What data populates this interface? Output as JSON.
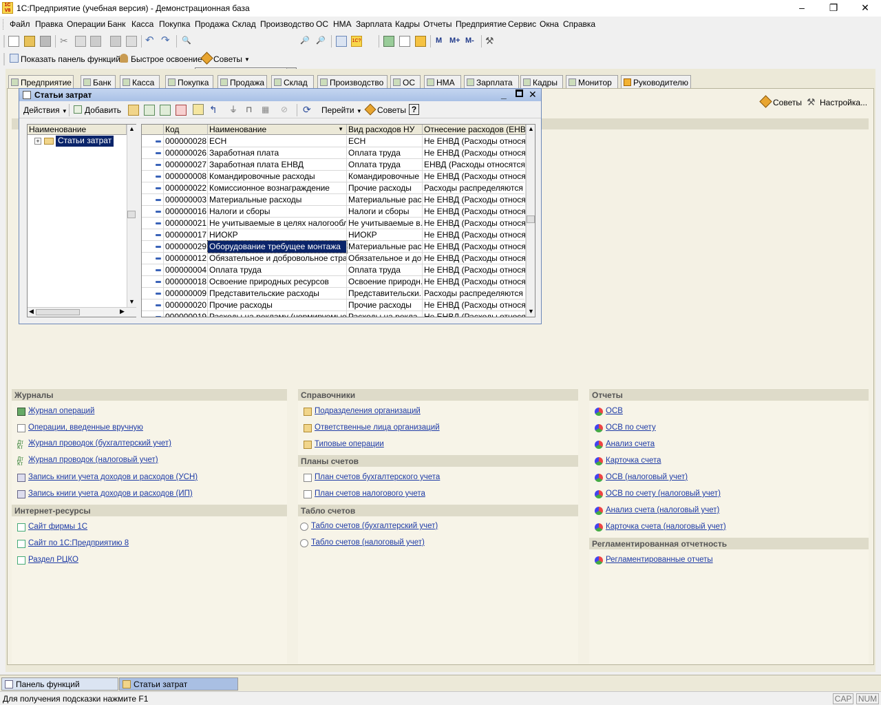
{
  "window": {
    "title": "1С:Предприятие (учебная версия) - Демонстрационная база",
    "app_icon_text": "1C V8",
    "controls": {
      "minimize": "–",
      "restore": "❐",
      "close": "✕"
    }
  },
  "menu": [
    "Файл",
    "Правка",
    "Операции",
    "Банк",
    "Касса",
    "Покупка",
    "Продажа",
    "Склад",
    "Производство",
    "ОС",
    "НМА",
    "Зарплата",
    "Кадры",
    "Отчеты",
    "Предприятие",
    "Сервис",
    "Окна",
    "Справка"
  ],
  "toolbar2": {
    "items": [
      {
        "label": "Показать панель функций",
        "icon": "panel-icon"
      },
      {
        "label": "Быстрое освоение",
        "icon": "person-icon"
      },
      {
        "label": "Советы",
        "icon": "tips-icon"
      }
    ]
  },
  "function_tabs": [
    {
      "label": "Предприятие"
    },
    {
      "label": "Банк"
    },
    {
      "label": "Касса"
    },
    {
      "label": "Покупка"
    },
    {
      "label": "Продажа"
    },
    {
      "label": "Склад"
    },
    {
      "label": "Производство"
    },
    {
      "label": "ОС"
    },
    {
      "label": "НМА"
    },
    {
      "label": "Зарплата"
    },
    {
      "label": "Кадры"
    },
    {
      "label": "Монитор"
    },
    {
      "label": "Руководителю"
    }
  ],
  "panel_toolbar": {
    "tips": "Советы",
    "settings": "Настройка..."
  },
  "catalog_window": {
    "title": "Статьи затрат",
    "toolbar": {
      "actions": "Действия",
      "add": "Добавить",
      "goto": "Перейти",
      "tips": "Советы",
      "help": "?"
    },
    "tree": {
      "header": "Наименование",
      "root": "Статьи затрат"
    },
    "grid": {
      "columns": [
        "Код",
        "Наименование",
        "Вид расходов НУ",
        "Отнесение расходов (ЕНВД)"
      ],
      "rows": [
        {
          "code": "000000028",
          "name": "ЕСН",
          "type": "ЕСН",
          "envd": "Не ЕНВД (Расходы относя..."
        },
        {
          "code": "000000026",
          "name": "Заработная плата",
          "type": "Оплата труда",
          "envd": "Не ЕНВД (Расходы относя..."
        },
        {
          "code": "000000027",
          "name": "Заработная плата ЕНВД",
          "type": "Оплата труда",
          "envd": "ЕНВД (Расходы относятся..."
        },
        {
          "code": "000000008",
          "name": "Командировочные расходы",
          "type": "Командировочные ...",
          "envd": "Не ЕНВД (Расходы относя..."
        },
        {
          "code": "000000022",
          "name": "Комиссионное вознаграждение",
          "type": "Прочие расходы",
          "envd": "Расходы распределяются"
        },
        {
          "code": "000000003",
          "name": "Материальные расходы",
          "type": "Материальные рас...",
          "envd": "Не ЕНВД (Расходы относя..."
        },
        {
          "code": "000000016",
          "name": "Налоги и сборы",
          "type": "Налоги и сборы",
          "envd": "Не ЕНВД (Расходы относя..."
        },
        {
          "code": "000000021",
          "name": "Не учитываемые в целях налогообло...",
          "type": "Не учитываемые в...",
          "envd": "Не ЕНВД (Расходы относя..."
        },
        {
          "code": "000000017",
          "name": "НИОКР",
          "type": "НИОКР",
          "envd": "Не ЕНВД (Расходы относя..."
        },
        {
          "code": "000000029",
          "name": "Оборудование требущее монтажа",
          "type": "Материальные рас...",
          "envd": "Не ЕНВД (Расходы относя...",
          "selected": true
        },
        {
          "code": "000000012",
          "name": "Обязательное и добровольное страх...",
          "type": "Обязательное и до...",
          "envd": "Не ЕНВД (Расходы относя..."
        },
        {
          "code": "000000004",
          "name": "Оплата труда",
          "type": "Оплата труда",
          "envd": "Не ЕНВД (Расходы относя..."
        },
        {
          "code": "000000018",
          "name": "Освоение природных ресурсов",
          "type": "Освоение природн...",
          "envd": "Не ЕНВД (Расходы относя..."
        },
        {
          "code": "000000009",
          "name": "Представительские расходы",
          "type": "Представительски...",
          "envd": "Расходы распределяются"
        },
        {
          "code": "000000020",
          "name": "Прочие расходы",
          "type": "Прочие расходы",
          "envd": "Не ЕНВД (Расходы относя..."
        },
        {
          "code": "000000019",
          "name": "Расходы на рекламу (нормируемые)",
          "type": "Расходы на рекла...",
          "envd": "Не ЕНВД (Расходы относя..."
        }
      ]
    }
  },
  "sections": {
    "journals": {
      "title": "Журналы",
      "links": [
        "Журнал операций",
        "Операции, введенные вручную",
        "Журнал проводок (бухгалтерский учет)",
        "Журнал проводок (налоговый учет)",
        "Запись книги учета доходов и расходов (УСН)",
        "Запись книги учета доходов и расходов (ИП)"
      ]
    },
    "internet": {
      "title": "Интернет-ресурсы",
      "links": [
        "Сайт фирмы 1С",
        "Сайт по 1С:Предприятию 8",
        "Раздел РЦКО"
      ]
    },
    "catalogs": {
      "title": "Справочники",
      "links": [
        "Подразделения организаций",
        "Ответственные лица организаций",
        "Типовые операции"
      ]
    },
    "charts": {
      "title": "Планы счетов",
      "links": [
        "План счетов бухгалтерского учета",
        "План счетов налогового учета"
      ]
    },
    "tablo": {
      "title": "Табло счетов",
      "links": [
        "Табло счетов (бухгалтерский учет)",
        "Табло счетов (налоговый учет)"
      ]
    },
    "reports": {
      "title": "Отчеты",
      "links": [
        "ОСВ",
        "ОСВ по счету",
        "Анализ счета",
        "Карточка счета",
        "ОСВ (налоговый учет)",
        "ОСВ по счету (налоговый учет)",
        "Анализ счета (налоговый учет)",
        "Карточка счета (налоговый учет)"
      ]
    },
    "regulated": {
      "title": "Регламентированная отчетность",
      "links": [
        "Регламентированные отчеты"
      ]
    }
  },
  "taskbar": [
    "Панель функций",
    "Статьи затрат"
  ],
  "status": {
    "hint": "Для получения подсказки нажмите F1",
    "cap": "CAP",
    "num": "NUM"
  },
  "colors": {
    "link": "#1d3aa6",
    "selection": "#0a246a",
    "panel_bg": "#f4f1e4",
    "heading_bg": "#dedbc9"
  }
}
